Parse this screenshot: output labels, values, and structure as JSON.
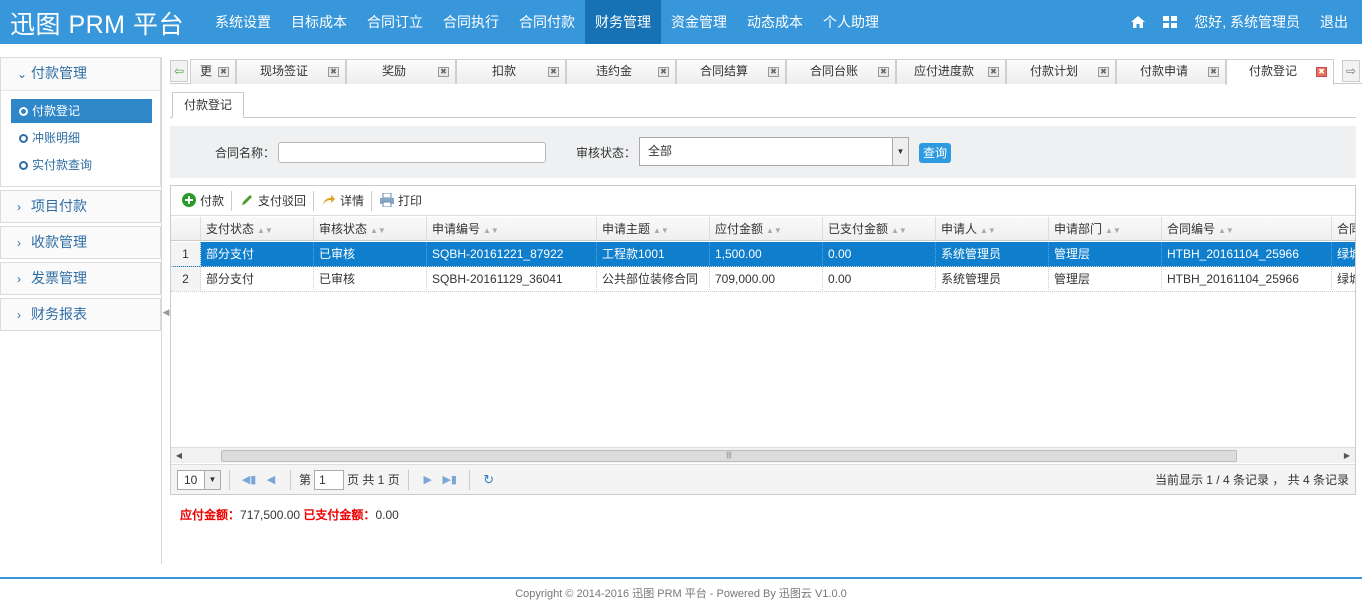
{
  "header": {
    "logo": "迅图 PRM 平台",
    "nav": [
      "系统设置",
      "目标成本",
      "合同订立",
      "合同执行",
      "合同付款",
      "财务管理",
      "资金管理",
      "动态成本",
      "个人助理"
    ],
    "active_nav": "财务管理",
    "greeting": "您好, 系统管理员",
    "logout": "退出",
    "icons": [
      "home-icon",
      "grid-icon"
    ]
  },
  "sidebar": {
    "open_group": "付款管理",
    "sub_items": [
      "付款登记",
      "冲账明细",
      "实付款查询"
    ],
    "active_sub": "付款登记",
    "groups": [
      "项目付款",
      "收款管理",
      "发票管理",
      "财务报表"
    ]
  },
  "tabs": [
    "更",
    "现场签证",
    "奖励",
    "扣款",
    "违约金",
    "合同结算",
    "合同台账",
    "应付进度款",
    "付款计划",
    "付款申请",
    "付款登记"
  ],
  "active_tab": "付款登记",
  "subtab": "付款登记",
  "filter": {
    "contract_label": "合同名称：",
    "contract_value": "",
    "status_label": "审核状态：",
    "status_value": "全部",
    "query_button": "查询"
  },
  "toolbar": {
    "pay": "付款",
    "reject": "支付驳回",
    "detail": "详情",
    "print": "打印"
  },
  "table": {
    "columns": [
      "支付状态",
      "审核状态",
      "申请编号",
      "申请主题",
      "应付金额",
      "已支付金额",
      "申请人",
      "申请部门",
      "合同编号",
      "合同"
    ],
    "rows": [
      {
        "num": "1",
        "cells": [
          "部分支付",
          "已审核",
          "SQBH-20161221_87922",
          "工程款1001",
          "1,500.00",
          "0.00",
          "系统管理员",
          "管理层",
          "HTBH_20161104_25966",
          "绿城"
        ]
      },
      {
        "num": "2",
        "cells": [
          "部分支付",
          "已审核",
          "SQBH-20161129_36041",
          "公共部位装修合同",
          "709,000.00",
          "0.00",
          "系统管理员",
          "管理层",
          "HTBH_20161104_25966",
          "绿城"
        ]
      }
    ],
    "selected_row": 0
  },
  "pager": {
    "page_size": "10",
    "page_prefix": "第",
    "page": "1",
    "page_suffix": "页 共 1 页",
    "info": "当前显示 1 / 4 条记录 ， 共 4 条记录"
  },
  "summary": {
    "payable_label": "应付金额：",
    "payable_value": "717,500.00",
    "paid_label": "已支付金额：",
    "paid_value": "0.00"
  },
  "footer": "Copyright © 2014-2016 迅图 PRM 平台 - Powered By 迅图云 V1.0.0",
  "colors": {
    "header": "#3797da",
    "nav_active": "#1672b5",
    "selected_row": "#0f7fcd",
    "summary_label": "#ee0000"
  }
}
